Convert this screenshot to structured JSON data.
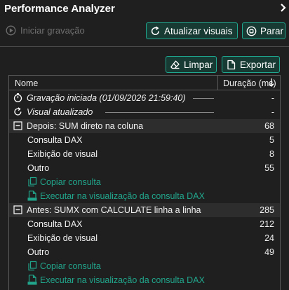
{
  "title": "Performance Analyzer",
  "toolbar": {
    "record_label": "Iniciar gravação",
    "refresh_label": "Atualizar visuais",
    "stop_label": "Parar",
    "clear_label": "Limpar",
    "export_label": "Exportar"
  },
  "grid": {
    "col_name": "Nome",
    "col_duration": "Duração (ms)",
    "rows": [
      {
        "type": "event",
        "icon": "stopwatch-icon",
        "label": "Gravação iniciada (01/09/2026 21:59:40)",
        "value": "-"
      },
      {
        "type": "event",
        "icon": "refresh-icon",
        "label": "Visual atualizado",
        "value": "-"
      },
      {
        "type": "group",
        "label": "Depois: SUM direto na coluna",
        "value": "68"
      },
      {
        "type": "item",
        "label": "Consulta DAX",
        "value": "5"
      },
      {
        "type": "item",
        "label": "Exibição de visual",
        "value": "8"
      },
      {
        "type": "item",
        "label": "Outro",
        "value": "55"
      },
      {
        "type": "action",
        "icon": "copy-icon",
        "label": "Copiar consulta"
      },
      {
        "type": "action",
        "icon": "dax-file-icon",
        "label": "Executar na visualização da consulta DAX"
      },
      {
        "type": "group",
        "label": "Antes: SUMX com CALCULATE linha a linha",
        "value": "285"
      },
      {
        "type": "item",
        "label": "Consulta DAX",
        "value": "212"
      },
      {
        "type": "item",
        "label": "Exibição de visual",
        "value": "24"
      },
      {
        "type": "item",
        "label": "Outro",
        "value": "49"
      },
      {
        "type": "action",
        "icon": "copy-icon",
        "label": "Copiar consulta"
      },
      {
        "type": "action",
        "icon": "dax-file-icon",
        "label": "Executar na visualização da consulta DAX"
      }
    ]
  },
  "colors": {
    "accent": "#21a58b",
    "button_bg": "#173a33",
    "background": "#1f1f1f",
    "group_row": "#2d2d2d"
  }
}
